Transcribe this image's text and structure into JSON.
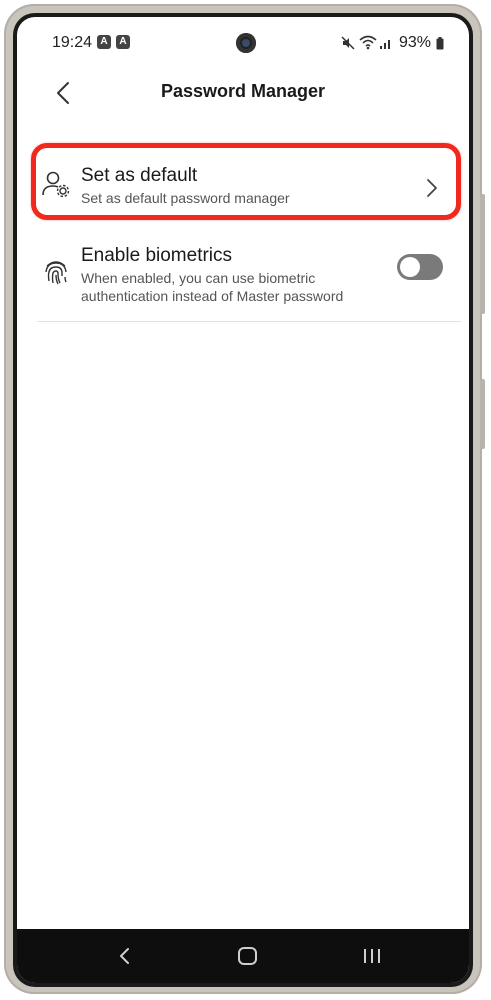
{
  "status_bar": {
    "time": "19:24",
    "badges": [
      "A",
      "A"
    ],
    "battery": "93%",
    "icons": [
      "mute-icon",
      "wifi-icon",
      "signal-icon",
      "battery-icon"
    ]
  },
  "header": {
    "title": "Password Manager",
    "back_icon": "back-arrow-icon"
  },
  "settings": {
    "default": {
      "title": "Set as default",
      "subtitle": "Set as default password manager",
      "icon": "user-gear-icon",
      "highlighted": true
    },
    "biometrics": {
      "title": "Enable biometrics",
      "subtitle": "When enabled, you can use biometric authentication instead of Master password",
      "icon": "fingerprint-icon",
      "enabled": false
    }
  },
  "nav_bar": {
    "icons": [
      "nav-back-icon",
      "nav-home-icon",
      "nav-recents-icon"
    ]
  },
  "colors": {
    "highlight": "#f0281e",
    "toggle_off": "#7a7a7a",
    "nav_bg": "#0e0e0e"
  }
}
